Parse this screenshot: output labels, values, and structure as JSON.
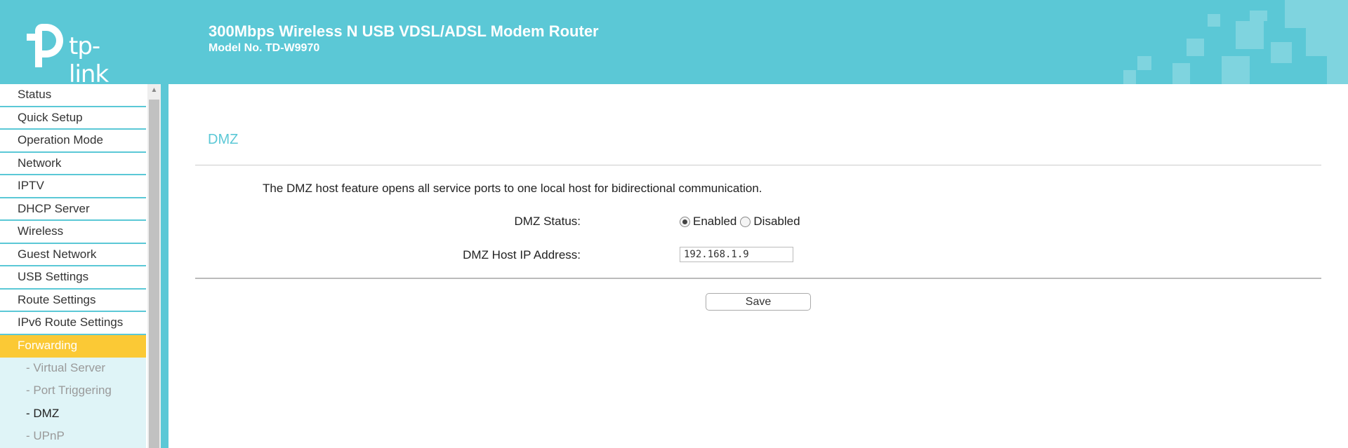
{
  "header": {
    "logo_text": "tp-link",
    "product_title": "300Mbps Wireless N USB VDSL/ADSL Modem Router",
    "model_no": "Model No. TD-W9970"
  },
  "sidebar": {
    "items": [
      {
        "label": "Status"
      },
      {
        "label": "Quick Setup"
      },
      {
        "label": "Operation Mode"
      },
      {
        "label": "Network"
      },
      {
        "label": "IPTV"
      },
      {
        "label": "DHCP Server"
      },
      {
        "label": "Wireless"
      },
      {
        "label": "Guest Network"
      },
      {
        "label": "USB Settings"
      },
      {
        "label": "Route Settings"
      },
      {
        "label": "IPv6 Route Settings"
      },
      {
        "label": "Forwarding"
      }
    ],
    "active_item": "Forwarding",
    "subitems": [
      {
        "label": "- Virtual Server"
      },
      {
        "label": "- Port Triggering"
      },
      {
        "label": "- DMZ"
      },
      {
        "label": "- UPnP"
      }
    ],
    "current_subitem": "- DMZ"
  },
  "main": {
    "section_title": "DMZ",
    "description": "The DMZ host feature opens all service ports to one local host for bidirectional communication.",
    "dmz_status": {
      "label": "DMZ Status:",
      "options": [
        "Enabled",
        "Disabled"
      ],
      "selected": "Enabled"
    },
    "dmz_host_ip": {
      "label": "DMZ Host IP Address:",
      "value": "192.168.1.9"
    },
    "save_label": "Save"
  },
  "colors": {
    "accent": "#5bc8d6",
    "active_menu": "#fbc935",
    "submenu_bg": "#dff4f7"
  }
}
